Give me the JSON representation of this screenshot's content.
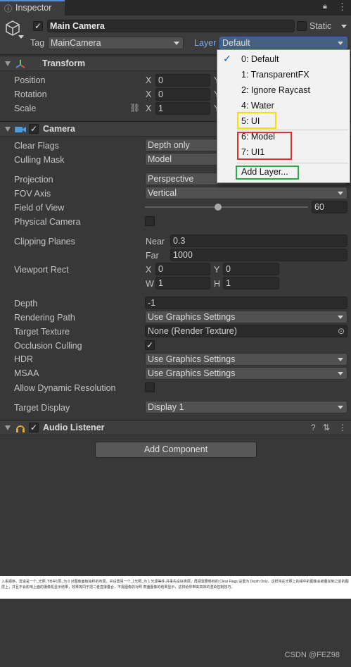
{
  "tab": {
    "label": "Inspector"
  },
  "object": {
    "name": "Main Camera",
    "static_label": "Static",
    "tag_label": "Tag",
    "tag_value": "MainCamera",
    "layer_label": "Layer",
    "layer_value": "Default"
  },
  "layer_menu": {
    "items": [
      "0: Default",
      "1: TransparentFX",
      "2: Ignore Raycast",
      "4: Water",
      "5: UI",
      "6: Model",
      "7: UI1"
    ],
    "checked": "0: Default",
    "add_layer": "Add Layer...",
    "highlight_colors": {
      "ui": "#f5e000",
      "custom": "#e03030",
      "add": "#2fa84a"
    }
  },
  "transform": {
    "title": "Transform",
    "position_label": "Position",
    "rotation_label": "Rotation",
    "scale_label": "Scale",
    "x_label": "X",
    "y_label": "Y",
    "position_x": "0",
    "rotation_x": "0",
    "scale_x": "1"
  },
  "camera": {
    "title": "Camera",
    "clear_flags_label": "Clear Flags",
    "clear_flags": "Depth only",
    "culling_mask_label": "Culling Mask",
    "culling_mask": "Model",
    "projection_label": "Projection",
    "projection": "Perspective",
    "fov_axis_label": "FOV Axis",
    "fov_axis": "Vertical",
    "fov_label": "Field of View",
    "fov_value": "60",
    "fov_fraction": 0.45,
    "physical_label": "Physical Camera",
    "clipping_label": "Clipping Planes",
    "near_label": "Near",
    "near": "0.3",
    "far_label": "Far",
    "far": "1000",
    "viewport_label": "Viewport Rect",
    "vp_x_label": "X",
    "vp_x": "0",
    "vp_y_label": "Y",
    "vp_y": "0",
    "vp_w_label": "W",
    "vp_w": "1",
    "vp_h_label": "H",
    "vp_h": "1",
    "depth_label": "Depth",
    "depth": "-1",
    "rendering_path_label": "Rendering Path",
    "rendering_path": "Use Graphics Settings",
    "target_texture_label": "Target Texture",
    "target_texture": "None (Render Texture)",
    "occlusion_label": "Occlusion Culling",
    "hdr_label": "HDR",
    "hdr": "Use Graphics Settings",
    "msaa_label": "MSAA",
    "msaa": "Use Graphics Settings",
    "dynamic_res_label": "Allow Dynamic Resolution",
    "target_display_label": "Target Display",
    "target_display": "Display 1"
  },
  "audio": {
    "title": "Audio Listener"
  },
  "add_component": "Add Component",
  "footer": {
    "text": "入系顺序。需说是一个_光照,下B中1层_为 0 对图像面板始终的布局，并设置另一个_1光照_为 1 光源等件,并事先设好类层。再把需要移到的 Clear Flags 设置为 Depth Only，这样将在光照上的镜中的图像会被叠加到之前的图层上，并且不会影响上面的摄像机显示结果，效果等同于把二者直接叠合，不需图像的对照 表面图像的结果显示，这将给你带来高效的渲染控制技巧。"
  },
  "watermark": "CSDN @FEZ98"
}
